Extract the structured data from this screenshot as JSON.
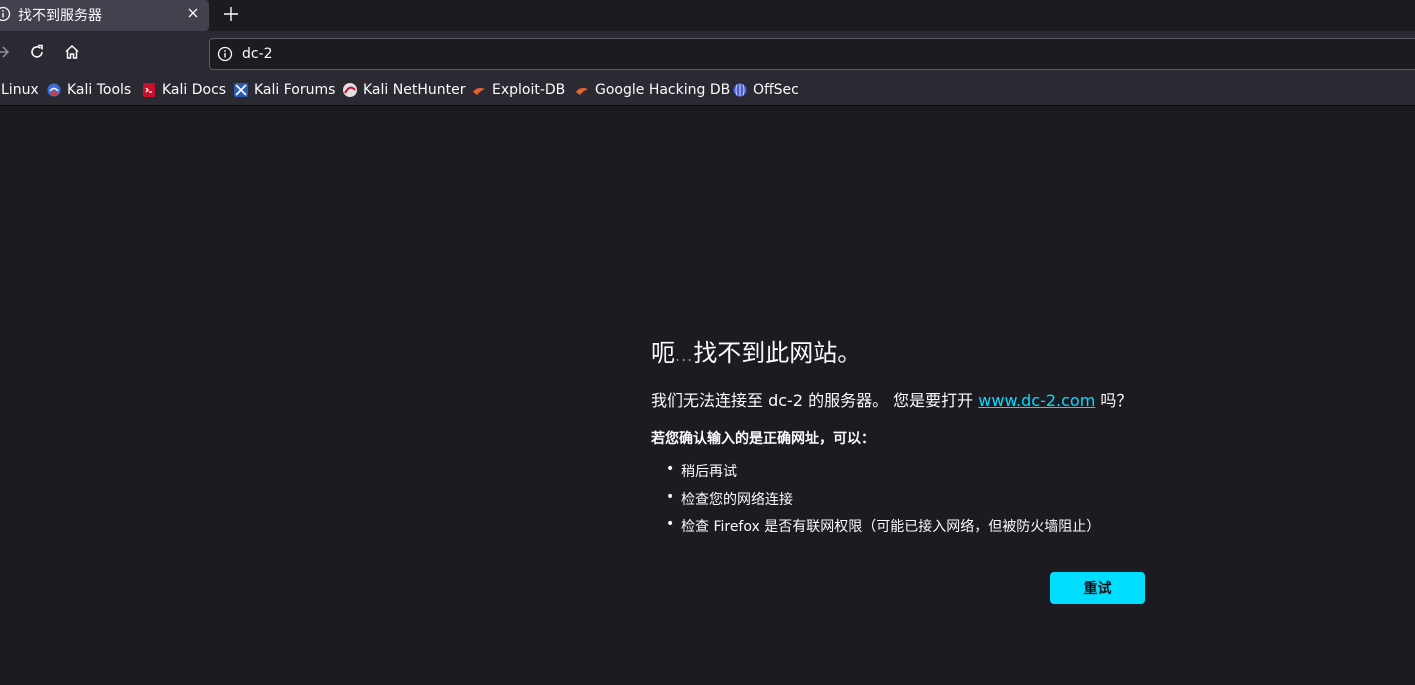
{
  "tab": {
    "title": "找不到服务器",
    "close_icon": "close-icon",
    "new_tab_icon": "plus-icon"
  },
  "nav": {
    "forward_icon": "arrow-right-icon",
    "reload_icon": "reload-icon",
    "home_icon": "home-icon"
  },
  "url": {
    "value": "dc-2",
    "info_icon": "info-icon"
  },
  "bookmarks": [
    {
      "label": "Linux",
      "icon": ""
    },
    {
      "label": "Kali Tools",
      "icon": "kali-tools-icon"
    },
    {
      "label": "Kali Docs",
      "icon": "kali-docs-icon"
    },
    {
      "label": "Kali Forums",
      "icon": "kali-forums-icon"
    },
    {
      "label": "Kali NetHunter",
      "icon": "kali-nethunter-icon"
    },
    {
      "label": "Exploit-DB",
      "icon": "exploit-db-icon"
    },
    {
      "label": "Google Hacking DB",
      "icon": "ghdb-icon"
    },
    {
      "label": "OffSec",
      "icon": "offsec-icon"
    }
  ],
  "error": {
    "title_a": "呃",
    "title_dots": "...",
    "title_b": "找不到此网站。",
    "desc_prefix": "我们无法连接至 dc-2 的服务器。 您是要打开 ",
    "desc_link": "www.dc-2.com",
    "desc_suffix": " 吗？",
    "subtitle": "若您确认输入的是正确网址，可以：",
    "tips": [
      "稍后再试",
      "检查您的网络连接",
      "检查 Firefox 是否有联网权限（可能已接入网络，但被防火墙阻止）"
    ],
    "retry_label": "重试"
  },
  "colors": {
    "accent": "#00ddff",
    "page_bg": "#1c1b22",
    "toolbar_bg": "#2b2a33",
    "tab_bg": "#42414d"
  }
}
